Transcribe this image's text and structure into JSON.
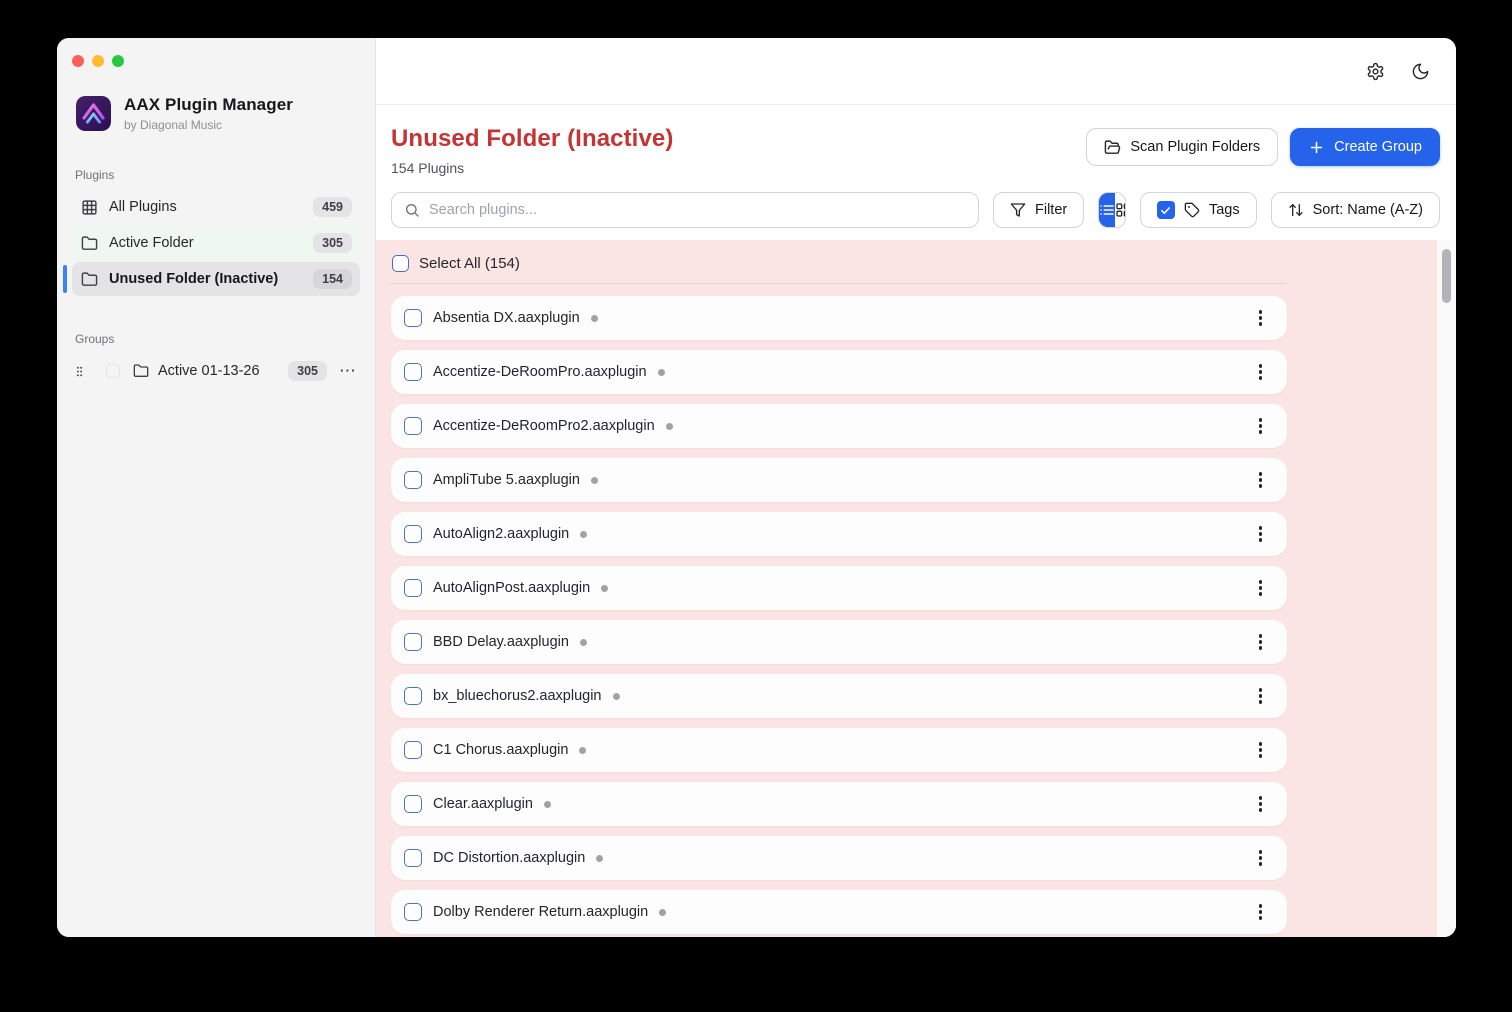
{
  "sidebar": {
    "app_title": "AAX Plugin Manager",
    "app_subtitle": "by Diagonal Music",
    "plugins_label": "Plugins",
    "items": [
      {
        "label": "All Plugins",
        "count": "459",
        "icon": "grid-icon"
      },
      {
        "label": "Active Folder",
        "count": "305",
        "icon": "folder-icon"
      },
      {
        "label": "Unused Folder (Inactive)",
        "count": "154",
        "icon": "folder-icon"
      }
    ],
    "groups_label": "Groups",
    "groups": [
      {
        "label": "Active 01-13-26",
        "count": "305",
        "menu": "⋯"
      }
    ]
  },
  "topbar": {
    "icons": [
      "settings-icon",
      "moon-icon"
    ]
  },
  "header": {
    "title": "Unused Folder (Inactive)",
    "subtitle": "154 Plugins",
    "scan_button": "Scan Plugin Folders",
    "create_button": "Create Group"
  },
  "toolbar": {
    "search_placeholder": "Search plugins...",
    "filter_label": "Filter",
    "tags_label": "Tags",
    "sort_label": "Sort: Name (A-Z)",
    "view_mode": "list"
  },
  "list": {
    "select_all": "Select All (154)",
    "plugins": [
      "Absentia DX.aaxplugin",
      "Accentize-DeRoomPro.aaxplugin",
      "Accentize-DeRoomPro2.aaxplugin",
      "AmpliTube 5.aaxplugin",
      "AutoAlign2.aaxplugin",
      "AutoAlignPost.aaxplugin",
      "BBD Delay.aaxplugin",
      "bx_bluechorus2.aaxplugin",
      "C1 Chorus.aaxplugin",
      "Clear.aaxplugin",
      "DC Distortion.aaxplugin",
      "Dolby Renderer Return.aaxplugin"
    ]
  },
  "colors": {
    "accent_blue": "#2563eb",
    "danger_red": "#c53434",
    "inactive_bg_pink": "#fbe5e4",
    "active_tint_green": "#eef8f0",
    "sidebar_bg": "#f4f4f5",
    "selected_item_bg": "#e4e4e7"
  }
}
